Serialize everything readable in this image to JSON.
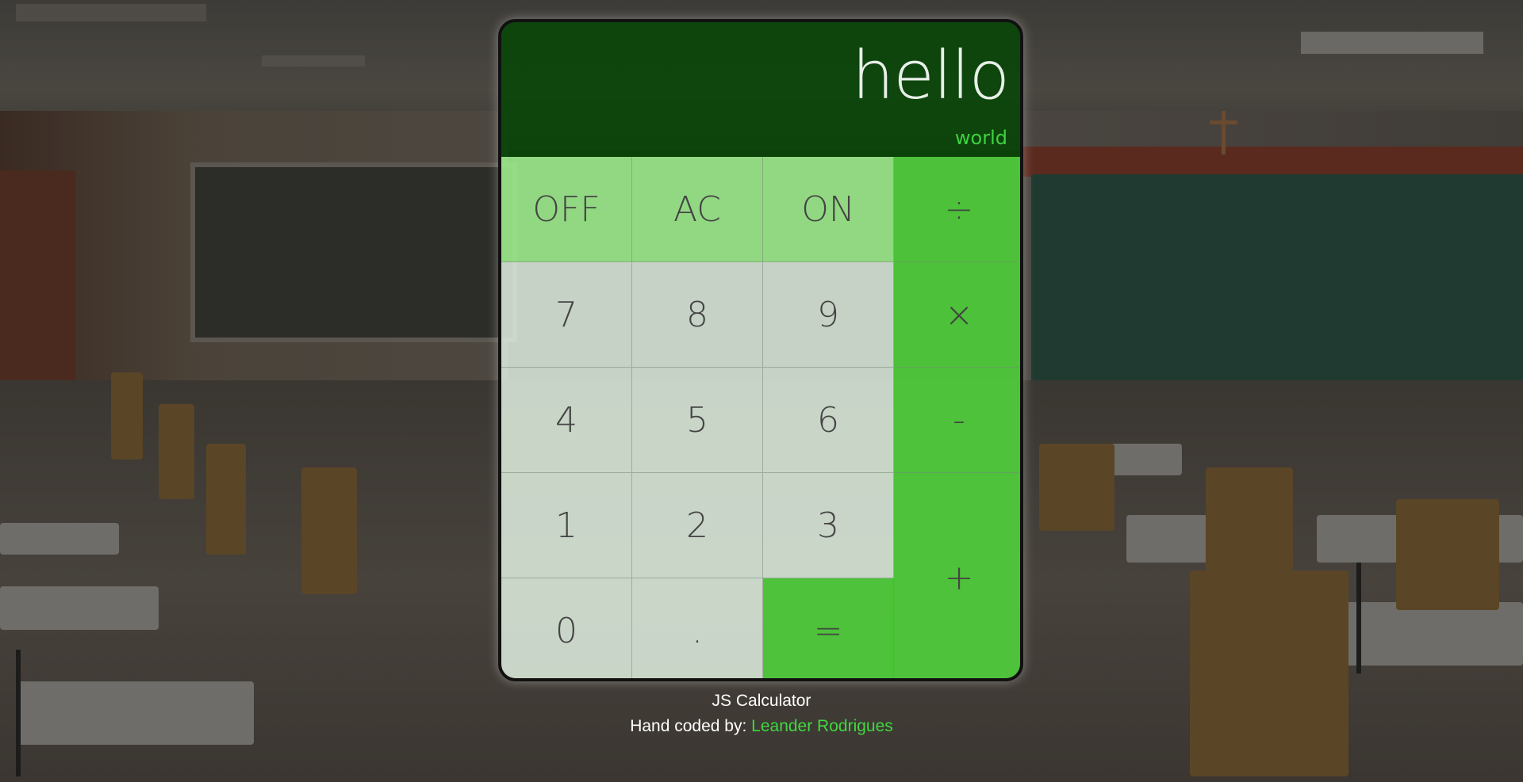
{
  "display": {
    "main": "hello",
    "sub": "world"
  },
  "keys": {
    "off": "OFF",
    "ac": "AC",
    "on": "ON",
    "divide": "÷",
    "seven": "7",
    "eight": "8",
    "nine": "9",
    "multiply": "×",
    "four": "4",
    "five": "5",
    "six": "6",
    "minus": "-",
    "one": "1",
    "two": "2",
    "three": "3",
    "plus": "+",
    "zero": "0",
    "dot": ".",
    "equals": "="
  },
  "footer": {
    "title": "JS Calculator",
    "credit_prefix": "Hand coded by:",
    "author": "Leander Rodrigues"
  },
  "colors": {
    "display_bg": "#0a4a0a",
    "function_keys": "#9ae68a",
    "number_keys": "#dcebdc",
    "operator_keys": "#4ec83a",
    "link": "#40d840"
  }
}
